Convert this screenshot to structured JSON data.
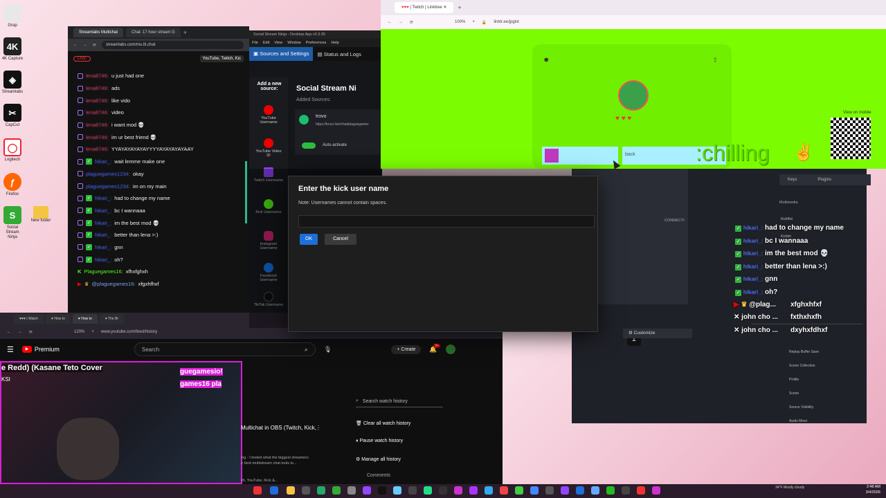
{
  "desktop_icons": [
    {
      "label": "Grap",
      "color": "#e8e8e8"
    },
    {
      "label": "4K Capture",
      "color": "#222"
    },
    {
      "label": "Streamlabs",
      "color": "#111"
    },
    {
      "label": "CapCut",
      "color": "#111"
    },
    {
      "label": "Logitech",
      "color": "#e23"
    },
    {
      "label": "Firefox",
      "color": "#f60"
    },
    {
      "label": "Social Stream Ninja",
      "color": "#3a3"
    }
  ],
  "streamlabs": {
    "tabs": [
      "Streamlabs Multichat",
      "Chat: 17 hour stream G"
    ],
    "url": "streamlabs.com/mu.lti.chat",
    "live": "LIVE",
    "platforms": "YouTube, Twitch, Kic",
    "messages": [
      {
        "user": "lena8746:",
        "text": "u just had one",
        "badge": "tw"
      },
      {
        "user": "lena8746:",
        "text": "ads",
        "badge": "tw"
      },
      {
        "user": "lena8746:",
        "text": "like vido",
        "badge": "tw"
      },
      {
        "user": "lena8746:",
        "text": "video",
        "badge": "tw"
      },
      {
        "user": "lena8746:",
        "text": "i want mod 💀",
        "badge": "tw"
      },
      {
        "user": "lena8746:",
        "text": "im ur best friend 💀",
        "badge": "tw"
      },
      {
        "user": "lena8746:",
        "text": "YYAYAYAYAYAYYYYAYAYAYAYAAY",
        "badge": "tw"
      },
      {
        "user": "hikari_:",
        "text": "wait lemme make one",
        "badge": "ok"
      },
      {
        "user": "plaguegames1234:",
        "text": "okay",
        "badge": "tw"
      },
      {
        "user": "plaguegames1234:",
        "text": "im on my main",
        "badge": "tw"
      },
      {
        "user": "hikari_:",
        "text": "had to change my name",
        "badge": "ok"
      },
      {
        "user": "hikari_:",
        "text": "bc I wannaaa",
        "badge": "ok"
      },
      {
        "user": "hikari_:",
        "text": "im the best mod 💀",
        "badge": "ok"
      },
      {
        "user": "hikari_:",
        "text": "better than lena >:)",
        "badge": "ok"
      },
      {
        "user": "hikari_:",
        "text": "gnn",
        "badge": "ok"
      },
      {
        "user": "hikari_:",
        "text": "oh?",
        "badge": "ok"
      }
    ],
    "kick_line": {
      "user": "Plaguegames16:",
      "text": "xfhxfghxh"
    },
    "mention_line": {
      "user": "@plaguegames16:",
      "text": "xfgxhfhxf"
    }
  },
  "ssn": {
    "title": "Social Stream Ninja - Desktop App v0.3.95",
    "menu": [
      "File",
      "Edit",
      "View",
      "Window",
      "Preferences",
      "Help"
    ],
    "tab_sources": "Sources and Settings",
    "tab_status": "Status and Logs",
    "add_source": "Add a new source:",
    "heading": "Social Stream Ni",
    "added_sources": "Added Sources:",
    "source_name": "trovo",
    "source_url": "https://trovo.live/chat/plaguegamer",
    "auto_activate": "Auto-activate",
    "source_buttons": [
      {
        "label": "YouTube Username",
        "color": "#e00"
      },
      {
        "label": "YouTube Video ID",
        "color": "#e00"
      },
      {
        "label": "Twitch Username",
        "color": "#9146ff"
      },
      {
        "label": "Kick Username",
        "color": "#53fc18"
      },
      {
        "label": "Instagram Username",
        "color": "#d62976"
      },
      {
        "label": "Facebook Username",
        "color": "#1877f2"
      },
      {
        "label": "TikTok Username",
        "color": "#111"
      }
    ]
  },
  "modal": {
    "title": "Enter the kick user name",
    "note": "Note: Usernames cannot contain spaces.",
    "input_value": "",
    "ok": "OK",
    "cancel": "Cancel"
  },
  "linktree": {
    "tab": "| Twitch | Linktree",
    "url": "linktr.ee/jpglol",
    "zoom": "100%",
    "chilling": ":chilling",
    "back": "back",
    "view_on_mobile": "View on mobile"
  },
  "obs": {
    "chat": [
      {
        "text": "had to change my name",
        "badge": "ok"
      },
      {
        "text": "bc I wannaaa",
        "badge": "ok"
      },
      {
        "text": "im the best mod 💀",
        "badge": "ok"
      },
      {
        "text": "better than lena >:)",
        "badge": "ok"
      },
      {
        "text": "gnn",
        "badge": "ok"
      },
      {
        "text": "oh?",
        "badge": "ok"
      },
      {
        "text": "@plag...",
        "badge": "yt"
      },
      {
        "text": "xfghxhfxf",
        "badge": "none"
      },
      {
        "text": "john cho ...",
        "badge": "x"
      },
      {
        "text": "fxthxhxfh",
        "badge": "none"
      },
      {
        "text": "john cho ...",
        "badge": "x"
      },
      {
        "text": "dxyhxfdhxf",
        "badge": "none"
      }
    ],
    "panel_tabs": [
      "Keys",
      "Plugins"
    ],
    "multimedia": "Multimedia",
    "connect": "CONNECTI",
    "customize": "Customize",
    "menu_items": [
      "KickBot",
      "Kicklet",
      "Replay Buffer Save",
      "Scene Collection",
      "Profile",
      "Scene",
      "Source Visibility",
      "Audio Mixer"
    ]
  },
  "youtube": {
    "url": "www.youtube.com/feed/history",
    "zoom": "120%",
    "logo": "Premium",
    "search_placeholder": "Search",
    "create": "Create",
    "notif_count": "9+",
    "video_title": "e Redd) (Kasane Teto Cover",
    "video_sub": "KSI",
    "stream_title": "Multichat in OBS (Twitch, Kick,",
    "stream_desc": "ing - I tested what the biggest streamers",
    "stream_desc2": "e best multistream chat tools to...",
    "stream_desc3": "ith, YouTube, Kick &...",
    "search_history": "Search watch history",
    "clear": "Clear all watch history",
    "pause": "Pause watch history",
    "manage": "Manage all history",
    "comments": "Comments",
    "overlay_text1": "guegamesio!",
    "overlay_text2": "games16 pla"
  },
  "tray": {
    "weather": "34°F Mostly cloudy",
    "time": "2:48 AM",
    "date": "3/4/2026"
  }
}
